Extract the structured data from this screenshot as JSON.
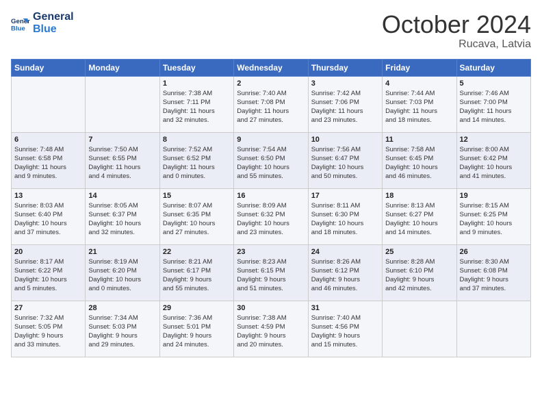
{
  "header": {
    "logo_line1": "General",
    "logo_line2": "Blue",
    "month_year": "October 2024",
    "location": "Rucava, Latvia"
  },
  "weekdays": [
    "Sunday",
    "Monday",
    "Tuesday",
    "Wednesday",
    "Thursday",
    "Friday",
    "Saturday"
  ],
  "weeks": [
    [
      {
        "day": "",
        "info": ""
      },
      {
        "day": "",
        "info": ""
      },
      {
        "day": "1",
        "info": "Sunrise: 7:38 AM\nSunset: 7:11 PM\nDaylight: 11 hours\nand 32 minutes."
      },
      {
        "day": "2",
        "info": "Sunrise: 7:40 AM\nSunset: 7:08 PM\nDaylight: 11 hours\nand 27 minutes."
      },
      {
        "day": "3",
        "info": "Sunrise: 7:42 AM\nSunset: 7:06 PM\nDaylight: 11 hours\nand 23 minutes."
      },
      {
        "day": "4",
        "info": "Sunrise: 7:44 AM\nSunset: 7:03 PM\nDaylight: 11 hours\nand 18 minutes."
      },
      {
        "day": "5",
        "info": "Sunrise: 7:46 AM\nSunset: 7:00 PM\nDaylight: 11 hours\nand 14 minutes."
      }
    ],
    [
      {
        "day": "6",
        "info": "Sunrise: 7:48 AM\nSunset: 6:58 PM\nDaylight: 11 hours\nand 9 minutes."
      },
      {
        "day": "7",
        "info": "Sunrise: 7:50 AM\nSunset: 6:55 PM\nDaylight: 11 hours\nand 4 minutes."
      },
      {
        "day": "8",
        "info": "Sunrise: 7:52 AM\nSunset: 6:52 PM\nDaylight: 11 hours\nand 0 minutes."
      },
      {
        "day": "9",
        "info": "Sunrise: 7:54 AM\nSunset: 6:50 PM\nDaylight: 10 hours\nand 55 minutes."
      },
      {
        "day": "10",
        "info": "Sunrise: 7:56 AM\nSunset: 6:47 PM\nDaylight: 10 hours\nand 50 minutes."
      },
      {
        "day": "11",
        "info": "Sunrise: 7:58 AM\nSunset: 6:45 PM\nDaylight: 10 hours\nand 46 minutes."
      },
      {
        "day": "12",
        "info": "Sunrise: 8:00 AM\nSunset: 6:42 PM\nDaylight: 10 hours\nand 41 minutes."
      }
    ],
    [
      {
        "day": "13",
        "info": "Sunrise: 8:03 AM\nSunset: 6:40 PM\nDaylight: 10 hours\nand 37 minutes."
      },
      {
        "day": "14",
        "info": "Sunrise: 8:05 AM\nSunset: 6:37 PM\nDaylight: 10 hours\nand 32 minutes."
      },
      {
        "day": "15",
        "info": "Sunrise: 8:07 AM\nSunset: 6:35 PM\nDaylight: 10 hours\nand 27 minutes."
      },
      {
        "day": "16",
        "info": "Sunrise: 8:09 AM\nSunset: 6:32 PM\nDaylight: 10 hours\nand 23 minutes."
      },
      {
        "day": "17",
        "info": "Sunrise: 8:11 AM\nSunset: 6:30 PM\nDaylight: 10 hours\nand 18 minutes."
      },
      {
        "day": "18",
        "info": "Sunrise: 8:13 AM\nSunset: 6:27 PM\nDaylight: 10 hours\nand 14 minutes."
      },
      {
        "day": "19",
        "info": "Sunrise: 8:15 AM\nSunset: 6:25 PM\nDaylight: 10 hours\nand 9 minutes."
      }
    ],
    [
      {
        "day": "20",
        "info": "Sunrise: 8:17 AM\nSunset: 6:22 PM\nDaylight: 10 hours\nand 5 minutes."
      },
      {
        "day": "21",
        "info": "Sunrise: 8:19 AM\nSunset: 6:20 PM\nDaylight: 10 hours\nand 0 minutes."
      },
      {
        "day": "22",
        "info": "Sunrise: 8:21 AM\nSunset: 6:17 PM\nDaylight: 9 hours\nand 55 minutes."
      },
      {
        "day": "23",
        "info": "Sunrise: 8:23 AM\nSunset: 6:15 PM\nDaylight: 9 hours\nand 51 minutes."
      },
      {
        "day": "24",
        "info": "Sunrise: 8:26 AM\nSunset: 6:12 PM\nDaylight: 9 hours\nand 46 minutes."
      },
      {
        "day": "25",
        "info": "Sunrise: 8:28 AM\nSunset: 6:10 PM\nDaylight: 9 hours\nand 42 minutes."
      },
      {
        "day": "26",
        "info": "Sunrise: 8:30 AM\nSunset: 6:08 PM\nDaylight: 9 hours\nand 37 minutes."
      }
    ],
    [
      {
        "day": "27",
        "info": "Sunrise: 7:32 AM\nSunset: 5:05 PM\nDaylight: 9 hours\nand 33 minutes."
      },
      {
        "day": "28",
        "info": "Sunrise: 7:34 AM\nSunset: 5:03 PM\nDaylight: 9 hours\nand 29 minutes."
      },
      {
        "day": "29",
        "info": "Sunrise: 7:36 AM\nSunset: 5:01 PM\nDaylight: 9 hours\nand 24 minutes."
      },
      {
        "day": "30",
        "info": "Sunrise: 7:38 AM\nSunset: 4:59 PM\nDaylight: 9 hours\nand 20 minutes."
      },
      {
        "day": "31",
        "info": "Sunrise: 7:40 AM\nSunset: 4:56 PM\nDaylight: 9 hours\nand 15 minutes."
      },
      {
        "day": "",
        "info": ""
      },
      {
        "day": "",
        "info": ""
      }
    ]
  ]
}
